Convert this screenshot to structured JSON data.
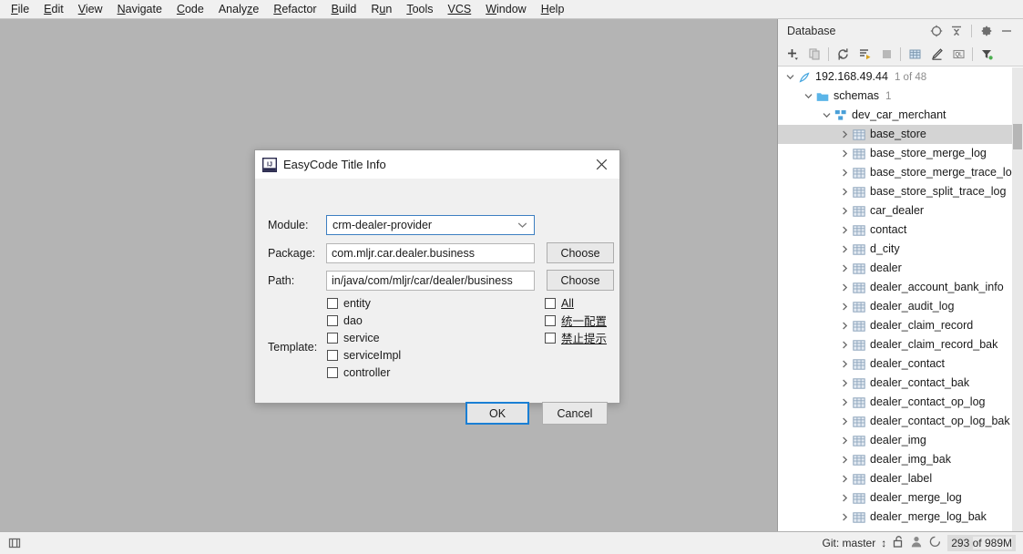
{
  "menubar": {
    "items": [
      {
        "label": "File",
        "mn": "F"
      },
      {
        "label": "Edit",
        "mn": "E"
      },
      {
        "label": "View",
        "mn": "V"
      },
      {
        "label": "Navigate",
        "mn": "N"
      },
      {
        "label": "Code",
        "mn": "C"
      },
      {
        "label": "Analyze",
        "mn": "z"
      },
      {
        "label": "Refactor",
        "mn": "R"
      },
      {
        "label": "Build",
        "mn": "B"
      },
      {
        "label": "Run",
        "mn": "u"
      },
      {
        "label": "Tools",
        "mn": "T"
      },
      {
        "label": "VCS",
        "mn": "VCS"
      },
      {
        "label": "Window",
        "mn": "W"
      },
      {
        "label": "Help",
        "mn": "H"
      }
    ]
  },
  "database_panel": {
    "title": "Database",
    "header_icons": [
      "locate-icon",
      "collapse-all-icon",
      "settings-gear-icon",
      "hide-minimize-icon"
    ],
    "toolbar_icons": [
      "add-plus-icon",
      "duplicate-icon",
      "refresh-icon",
      "run-sql-script-icon",
      "stop-icon",
      "table-editor-icon",
      "edit-pencil-icon",
      "ql-console-icon",
      "filter-icon"
    ],
    "tree": [
      {
        "label": "192.168.49.44",
        "count": "1 of 48",
        "indent": 0,
        "icon": "datasource-icon",
        "twisty": "down",
        "selected": false
      },
      {
        "label": "schemas",
        "count": "1",
        "indent": 1,
        "icon": "folder-icon",
        "twisty": "down",
        "selected": false
      },
      {
        "label": "dev_car_merchant",
        "count": "",
        "indent": 2,
        "icon": "schema-icon",
        "twisty": "down",
        "selected": false
      },
      {
        "label": "base_store",
        "count": "",
        "indent": 3,
        "icon": "table-icon",
        "twisty": "right",
        "selected": true
      },
      {
        "label": "base_store_merge_log",
        "count": "",
        "indent": 3,
        "icon": "table-icon",
        "twisty": "right",
        "selected": false
      },
      {
        "label": "base_store_merge_trace_log",
        "count": "",
        "indent": 3,
        "icon": "table-icon",
        "twisty": "right",
        "selected": false
      },
      {
        "label": "base_store_split_trace_log",
        "count": "",
        "indent": 3,
        "icon": "table-icon",
        "twisty": "right",
        "selected": false
      },
      {
        "label": "car_dealer",
        "count": "",
        "indent": 3,
        "icon": "table-icon",
        "twisty": "right",
        "selected": false
      },
      {
        "label": "contact",
        "count": "",
        "indent": 3,
        "icon": "table-icon",
        "twisty": "right",
        "selected": false
      },
      {
        "label": "d_city",
        "count": "",
        "indent": 3,
        "icon": "table-icon",
        "twisty": "right",
        "selected": false
      },
      {
        "label": "dealer",
        "count": "",
        "indent": 3,
        "icon": "table-icon",
        "twisty": "right",
        "selected": false
      },
      {
        "label": "dealer_account_bank_info",
        "count": "",
        "indent": 3,
        "icon": "table-icon",
        "twisty": "right",
        "selected": false
      },
      {
        "label": "dealer_audit_log",
        "count": "",
        "indent": 3,
        "icon": "table-icon",
        "twisty": "right",
        "selected": false
      },
      {
        "label": "dealer_claim_record",
        "count": "",
        "indent": 3,
        "icon": "table-icon",
        "twisty": "right",
        "selected": false
      },
      {
        "label": "dealer_claim_record_bak",
        "count": "",
        "indent": 3,
        "icon": "table-icon",
        "twisty": "right",
        "selected": false
      },
      {
        "label": "dealer_contact",
        "count": "",
        "indent": 3,
        "icon": "table-icon",
        "twisty": "right",
        "selected": false
      },
      {
        "label": "dealer_contact_bak",
        "count": "",
        "indent": 3,
        "icon": "table-icon",
        "twisty": "right",
        "selected": false
      },
      {
        "label": "dealer_contact_op_log",
        "count": "",
        "indent": 3,
        "icon": "table-icon",
        "twisty": "right",
        "selected": false
      },
      {
        "label": "dealer_contact_op_log_bak",
        "count": "",
        "indent": 3,
        "icon": "table-icon",
        "twisty": "right",
        "selected": false
      },
      {
        "label": "dealer_img",
        "count": "",
        "indent": 3,
        "icon": "table-icon",
        "twisty": "right",
        "selected": false
      },
      {
        "label": "dealer_img_bak",
        "count": "",
        "indent": 3,
        "icon": "table-icon",
        "twisty": "right",
        "selected": false
      },
      {
        "label": "dealer_label",
        "count": "",
        "indent": 3,
        "icon": "table-icon",
        "twisty": "right",
        "selected": false
      },
      {
        "label": "dealer_merge_log",
        "count": "",
        "indent": 3,
        "icon": "table-icon",
        "twisty": "right",
        "selected": false
      },
      {
        "label": "dealer_merge_log_bak",
        "count": "",
        "indent": 3,
        "icon": "table-icon",
        "twisty": "right",
        "selected": false
      }
    ]
  },
  "dialog": {
    "title": "EasyCode Title Info",
    "close_label": "✕",
    "module": {
      "label": "Module:",
      "value": "crm-dealer-provider"
    },
    "package": {
      "label": "Package:",
      "value": "com.mljr.car.dealer.business",
      "button": "Choose"
    },
    "path": {
      "label": "Path:",
      "value": "in/java/com/mljr/car/dealer/business",
      "button": "Choose"
    },
    "template": {
      "label": "Template:",
      "left_options": [
        {
          "label": "entity",
          "checked": false
        },
        {
          "label": "dao",
          "checked": false
        },
        {
          "label": "service",
          "checked": false
        },
        {
          "label": "serviceImpl",
          "checked": false
        },
        {
          "label": "controller",
          "checked": false
        }
      ],
      "right_options": [
        {
          "label": "All",
          "checked": false
        },
        {
          "label": "统一配置",
          "checked": false
        },
        {
          "label": "禁止提示",
          "checked": false
        }
      ]
    },
    "ok_label": "OK",
    "cancel_label": "Cancel"
  },
  "statusbar": {
    "left_icon": "toggle-toolwindow-icon",
    "git_branch": "Git: master",
    "branch_arrows": "↕",
    "icons": [
      "lock-open-icon",
      "person-icon",
      "notification-icon"
    ],
    "memory_used": "293",
    "memory_of": "of",
    "memory_total": "989M"
  },
  "colors": {
    "accent_blue": "#1a7fd4",
    "selection_gray": "#d4d4d4",
    "panel_bg": "#f0f0f0",
    "editor_bg": "#b4b4b4"
  }
}
